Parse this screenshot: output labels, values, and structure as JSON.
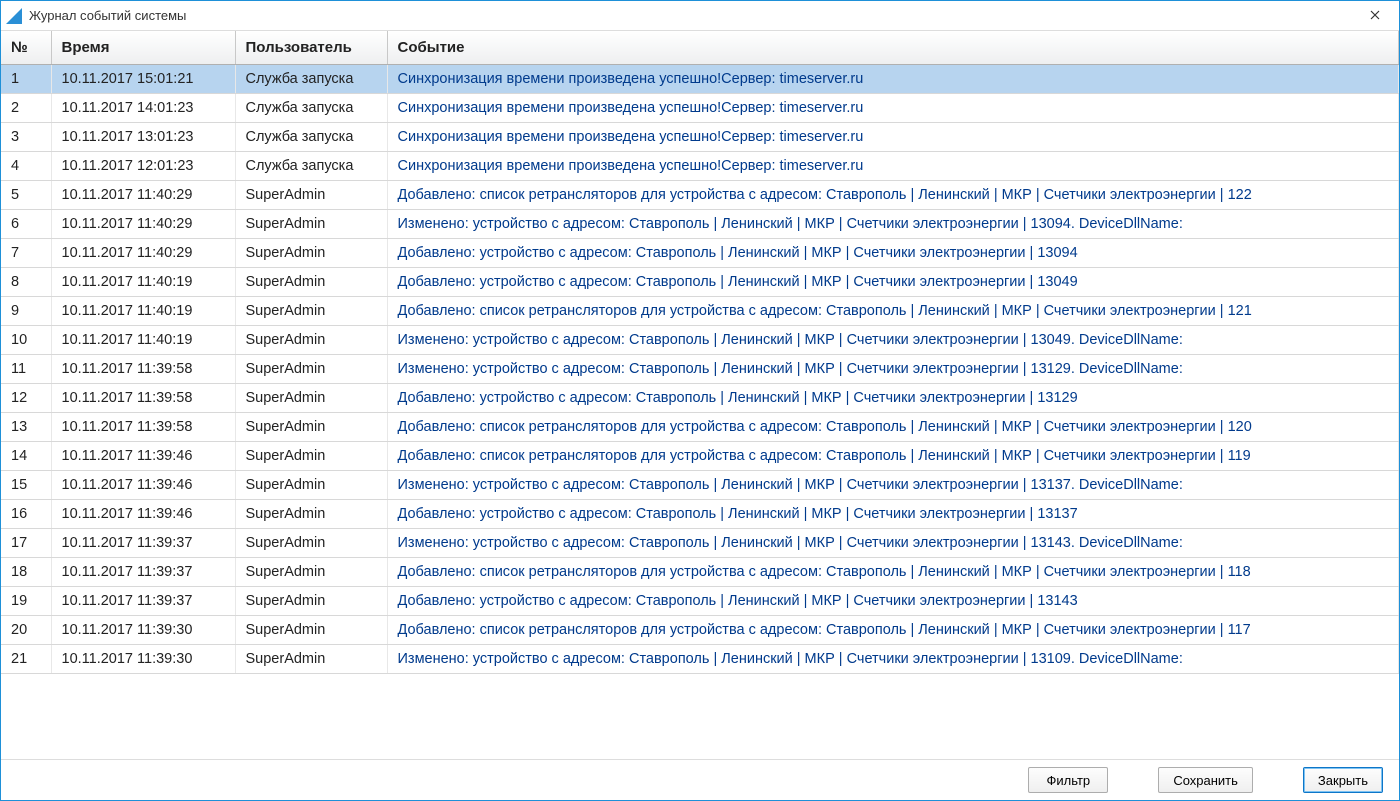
{
  "window": {
    "title": "Журнал событий системы"
  },
  "columns": {
    "num": "№",
    "time": "Время",
    "user": "Пользователь",
    "event": "Событие"
  },
  "selected_row_index": 0,
  "rows": [
    {
      "n": "1",
      "time": "10.11.2017 15:01:21",
      "user": "Служба запуска",
      "event": "Синхронизация времени произведена успешно!Сервер: timeserver.ru"
    },
    {
      "n": "2",
      "time": "10.11.2017 14:01:23",
      "user": "Служба запуска",
      "event": "Синхронизация времени произведена успешно!Сервер: timeserver.ru"
    },
    {
      "n": "3",
      "time": "10.11.2017 13:01:23",
      "user": "Служба запуска",
      "event": "Синхронизация времени произведена успешно!Сервер: timeserver.ru"
    },
    {
      "n": "4",
      "time": "10.11.2017 12:01:23",
      "user": "Служба запуска",
      "event": "Синхронизация времени произведена успешно!Сервер: timeserver.ru"
    },
    {
      "n": "5",
      "time": "10.11.2017 11:40:29",
      "user": "SuperAdmin",
      "event": "Добавлено: список ретрансляторов для устройства с адресом: Ставрополь | Ленинский | МКР | Счетчики электроэнергии | 122"
    },
    {
      "n": "6",
      "time": "10.11.2017 11:40:29",
      "user": "SuperAdmin",
      "event": "Изменено: устройство с адресом: Ставрополь | Ленинский | МКР | Счетчики электроэнергии | 13094. DeviceDllName:"
    },
    {
      "n": "7",
      "time": "10.11.2017 11:40:29",
      "user": "SuperAdmin",
      "event": "Добавлено: устройство с адресом: Ставрополь | Ленинский | МКР | Счетчики электроэнергии | 13094"
    },
    {
      "n": "8",
      "time": "10.11.2017 11:40:19",
      "user": "SuperAdmin",
      "event": "Добавлено: устройство с адресом: Ставрополь | Ленинский | МКР | Счетчики электроэнергии | 13049"
    },
    {
      "n": "9",
      "time": "10.11.2017 11:40:19",
      "user": "SuperAdmin",
      "event": "Добавлено: список ретрансляторов для устройства с адресом: Ставрополь | Ленинский | МКР | Счетчики электроэнергии | 121"
    },
    {
      "n": "10",
      "time": "10.11.2017 11:40:19",
      "user": "SuperAdmin",
      "event": "Изменено: устройство с адресом: Ставрополь | Ленинский | МКР | Счетчики электроэнергии | 13049. DeviceDllName:"
    },
    {
      "n": "11",
      "time": "10.11.2017 11:39:58",
      "user": "SuperAdmin",
      "event": "Изменено: устройство с адресом: Ставрополь | Ленинский | МКР | Счетчики электроэнергии | 13129. DeviceDllName:"
    },
    {
      "n": "12",
      "time": "10.11.2017 11:39:58",
      "user": "SuperAdmin",
      "event": "Добавлено: устройство с адресом: Ставрополь | Ленинский | МКР | Счетчики электроэнергии | 13129"
    },
    {
      "n": "13",
      "time": "10.11.2017 11:39:58",
      "user": "SuperAdmin",
      "event": "Добавлено: список ретрансляторов для устройства с адресом: Ставрополь | Ленинский | МКР | Счетчики электроэнергии | 120"
    },
    {
      "n": "14",
      "time": "10.11.2017 11:39:46",
      "user": "SuperAdmin",
      "event": "Добавлено: список ретрансляторов для устройства с адресом: Ставрополь | Ленинский | МКР | Счетчики электроэнергии | 119"
    },
    {
      "n": "15",
      "time": "10.11.2017 11:39:46",
      "user": "SuperAdmin",
      "event": "Изменено: устройство с адресом: Ставрополь | Ленинский | МКР | Счетчики электроэнергии | 13137. DeviceDllName:"
    },
    {
      "n": "16",
      "time": "10.11.2017 11:39:46",
      "user": "SuperAdmin",
      "event": "Добавлено: устройство с адресом: Ставрополь | Ленинский | МКР | Счетчики электроэнергии | 13137"
    },
    {
      "n": "17",
      "time": "10.11.2017 11:39:37",
      "user": "SuperAdmin",
      "event": "Изменено: устройство с адресом: Ставрополь | Ленинский | МКР | Счетчики электроэнергии | 13143. DeviceDllName:"
    },
    {
      "n": "18",
      "time": "10.11.2017 11:39:37",
      "user": "SuperAdmin",
      "event": "Добавлено: список ретрансляторов для устройства с адресом: Ставрополь | Ленинский | МКР | Счетчики электроэнергии | 118"
    },
    {
      "n": "19",
      "time": "10.11.2017 11:39:37",
      "user": "SuperAdmin",
      "event": "Добавлено: устройство с адресом: Ставрополь | Ленинский | МКР | Счетчики электроэнергии | 13143"
    },
    {
      "n": "20",
      "time": "10.11.2017 11:39:30",
      "user": "SuperAdmin",
      "event": "Добавлено: список ретрансляторов для устройства с адресом: Ставрополь | Ленинский | МКР | Счетчики электроэнергии | 117"
    },
    {
      "n": "21",
      "time": "10.11.2017 11:39:30",
      "user": "SuperAdmin",
      "event": "Изменено: устройство с адресом: Ставрополь | Ленинский | МКР | Счетчики электроэнергии | 13109. DeviceDllName:"
    }
  ],
  "footer": {
    "filter": "Фильтр",
    "save": "Сохранить",
    "close": "Закрыть"
  }
}
